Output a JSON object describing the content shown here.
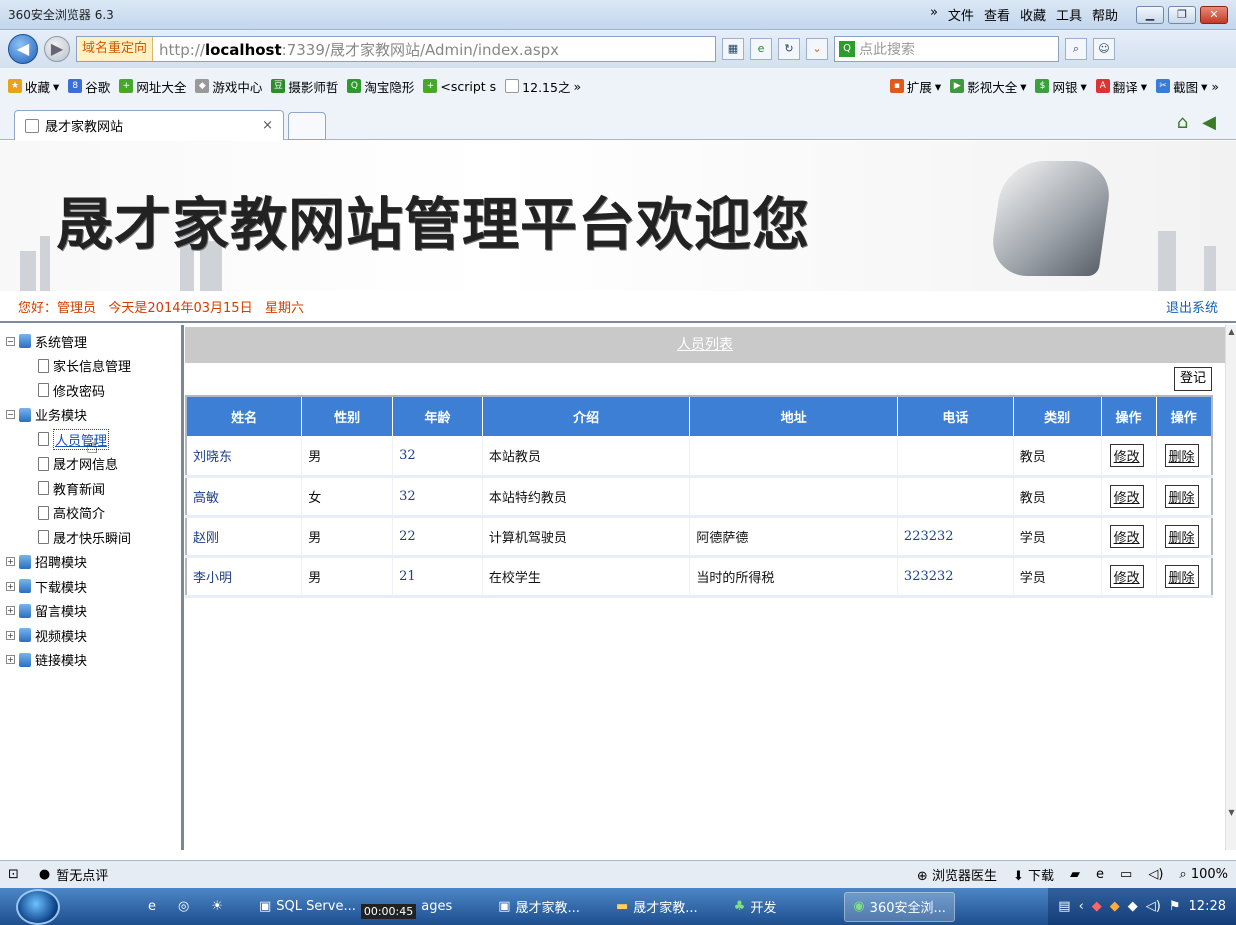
{
  "browser": {
    "app_title": "360安全浏览器 6.3",
    "menu": [
      "»",
      "文件",
      "查看",
      "收藏",
      "工具",
      "帮助"
    ],
    "redirect_label": "域名重定向",
    "url_prefix": "http://",
    "url_host": "localhost",
    "url_rest": ":7339/晟才家教网站/Admin/index.aspx",
    "search_placeholder": "点此搜索",
    "favorites": [
      "收藏",
      "谷歌",
      "网址大全",
      "游戏中心",
      "摄影师哲",
      "淘宝隐形",
      "<script s",
      "12.15之"
    ],
    "favorites_more": "»",
    "favorites_right": [
      "扩展",
      "影视大全",
      "网银",
      "翻译",
      "截图"
    ],
    "tab_title": "晟才家教网站",
    "tab_close": "×"
  },
  "site": {
    "banner_title": "晟才家教网站管理平台欢迎您",
    "greeting": "您好：管理员   今天是2014年03月15日   星期六",
    "logout": "退出系统"
  },
  "sidebar": {
    "tree": [
      {
        "label": "系统管理",
        "type": "group",
        "expanded": true
      },
      {
        "label": "家长信息管理",
        "type": "item"
      },
      {
        "label": "修改密码",
        "type": "item"
      },
      {
        "label": "业务模块",
        "type": "group",
        "expanded": true
      },
      {
        "label": "人员管理",
        "type": "item",
        "active": true
      },
      {
        "label": "晟才网信息",
        "type": "item"
      },
      {
        "label": "教育新闻",
        "type": "item"
      },
      {
        "label": "高校简介",
        "type": "item"
      },
      {
        "label": "晟才快乐瞬间",
        "type": "item"
      },
      {
        "label": "招聘模块",
        "type": "group",
        "expanded": false
      },
      {
        "label": "下载模块",
        "type": "group",
        "expanded": false
      },
      {
        "label": "留言模块",
        "type": "group",
        "expanded": false
      },
      {
        "label": "视频模块",
        "type": "group",
        "expanded": false
      },
      {
        "label": "链接模块",
        "type": "group",
        "expanded": false
      }
    ]
  },
  "main": {
    "caption": "人员列表",
    "register_button": "登记",
    "columns": [
      "姓名",
      "性别",
      "年龄",
      "介绍",
      "地址",
      "电话",
      "类别",
      "操作",
      "操作"
    ],
    "rows": [
      {
        "name": "刘晓东",
        "gender": "男",
        "age": "32",
        "intro": "本站教员",
        "address": "",
        "phone": "",
        "category": "教员"
      },
      {
        "name": "高敏",
        "gender": "女",
        "age": "32",
        "intro": "本站特约教员",
        "address": "",
        "phone": "",
        "category": "教员"
      },
      {
        "name": "赵刚",
        "gender": "男",
        "age": "22",
        "intro": "计算机驾驶员",
        "address": "阿德萨德",
        "phone": "223232",
        "category": "学员"
      },
      {
        "name": "李小明",
        "gender": "男",
        "age": "21",
        "intro": "在校学生",
        "address": "当时的所得税",
        "phone": "323232",
        "category": "学员"
      }
    ],
    "edit_label": "修改",
    "delete_label": "删除"
  },
  "statusbar": {
    "comment": "暂无点评",
    "doctor": "浏览器医生",
    "download": "下载",
    "zoom": "100%"
  },
  "taskbar": {
    "items": [
      "SQL Serve...",
      "ages",
      "晟才家教...",
      "晟才家教...",
      "开发",
      "360安全浏..."
    ],
    "timer": "00:00:45",
    "clock": "12:28"
  }
}
